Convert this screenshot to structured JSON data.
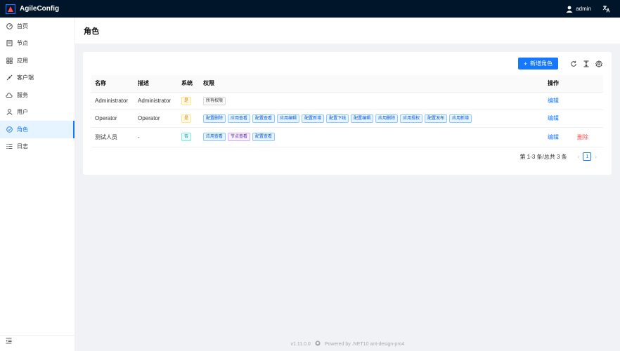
{
  "app": {
    "title": "AgileConfig",
    "user": "admin"
  },
  "sidebar": {
    "items": [
      {
        "label": "首页",
        "icon": "dashboard-icon"
      },
      {
        "label": "节点",
        "icon": "node-icon"
      },
      {
        "label": "应用",
        "icon": "app-icon"
      },
      {
        "label": "客户端",
        "icon": "client-icon"
      },
      {
        "label": "服务",
        "icon": "cloud-icon"
      },
      {
        "label": "用户",
        "icon": "user-icon"
      },
      {
        "label": "角色",
        "icon": "role-icon",
        "active": true
      },
      {
        "label": "日志",
        "icon": "log-icon"
      }
    ]
  },
  "page": {
    "title": "角色"
  },
  "toolbar": {
    "add_label": "新增角色"
  },
  "table": {
    "headers": {
      "name": "名称",
      "desc": "描述",
      "system": "系统",
      "permissions": "权限",
      "actions": "操作"
    },
    "rows": [
      {
        "name": "Administrator",
        "desc": "Administrator",
        "system": "是",
        "permissions": [
          "所有权限"
        ],
        "edit": "编辑",
        "delete": ""
      },
      {
        "name": "Operator",
        "desc": "Operator",
        "system": "是",
        "permissions": [
          "配置删除",
          "应用查看",
          "配置查看",
          "应用编辑",
          "配置新增",
          "配置下线",
          "配置编辑",
          "应用删除",
          "应用授权",
          "配置发布",
          "应用新增"
        ],
        "edit": "编辑",
        "delete": ""
      },
      {
        "name": "测试人员",
        "desc": "-",
        "system": "否",
        "permissions": [
          "应用查看",
          "节点查看",
          "配置查看"
        ],
        "edit": "编辑",
        "delete": "删除"
      }
    ]
  },
  "pagination": {
    "total_text": "第 1-3 条/总共 3 条",
    "current": "1"
  },
  "footer": {
    "version": "v1.11.0.0",
    "powered": "Powered by .NET10 ant-design-pro4"
  },
  "colors": {
    "primary": "#1677ff",
    "header_bg": "#001529",
    "danger": "#ff4d4f"
  }
}
